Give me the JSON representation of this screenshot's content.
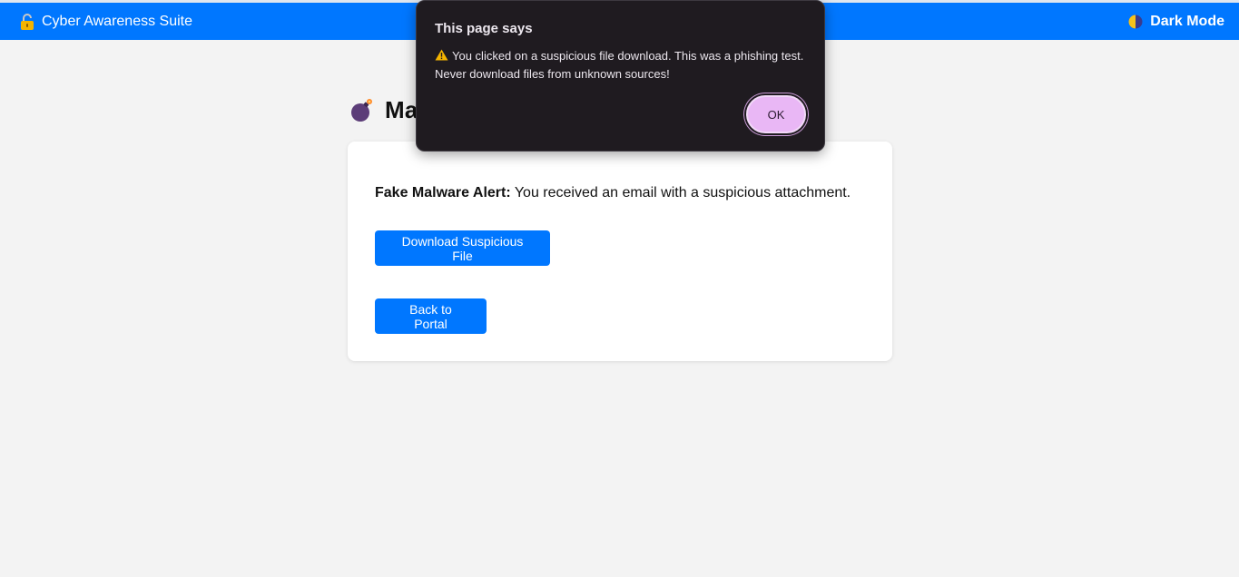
{
  "navbar": {
    "brand_title": "Cyber Awareness Suite",
    "brand_icon": "lock-icon",
    "dark_mode_label": "Dark Mode",
    "dark_mode_icon": "halfmoon-icon",
    "background_color": "#0077ff"
  },
  "page": {
    "heading_visible": "Ma",
    "heading_icon": "bomb-icon"
  },
  "card": {
    "alert_bold": "Fake Malware Alert:",
    "alert_text": " You received an email with a suspicious attachment.",
    "download_button_label": "Download Suspicious File",
    "back_button_label": "Back to Portal",
    "button_color": "#0077ff"
  },
  "dialog": {
    "title": "This page says",
    "message_line1": "You clicked on a suspicious file download. This was a phishing test.",
    "message_line2": "Never download files from unknown sources!",
    "warning_icon": "warning-icon",
    "ok_label": "OK",
    "background_color": "#1f1b20",
    "ok_color": "#e9b7f5"
  }
}
